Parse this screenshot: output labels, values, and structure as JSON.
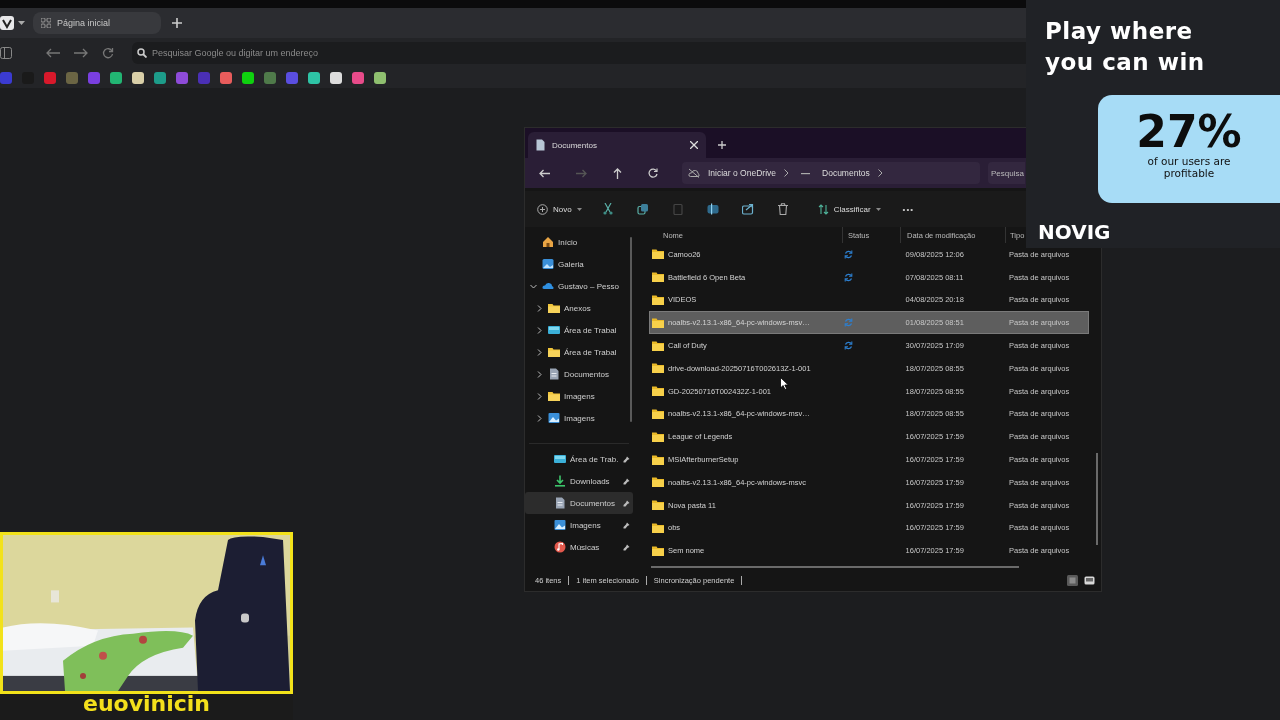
{
  "browser": {
    "tab": {
      "title": "Página inicial"
    },
    "address": {
      "placeholder": "Pesquisar Google ou digitar um endereço"
    },
    "bookmarks": [
      {
        "color": "#3b3bd1"
      },
      {
        "color": "#1a1a1a"
      },
      {
        "color": "#d8192b"
      },
      {
        "color": "#6b6544"
      },
      {
        "color": "#7a3fe0"
      },
      {
        "color": "#22b573"
      },
      {
        "color": "#d9cfa8"
      },
      {
        "color": "#1d9c8a"
      },
      {
        "color": "#8e4bd9"
      },
      {
        "color": "#4a2fb5"
      },
      {
        "color": "#e85c5c"
      },
      {
        "color": "#0fd10f"
      },
      {
        "color": "#4f7a4a"
      },
      {
        "color": "#5a4ee0"
      },
      {
        "color": "#2ec4a6"
      },
      {
        "color": "#dddddd"
      },
      {
        "color": "#e84b8a"
      },
      {
        "color": "#8fbf6f"
      }
    ]
  },
  "explorer": {
    "tab": {
      "title": "Documentos"
    },
    "breadcrumb": [
      "Iniciar o OneDrive",
      "Documentos"
    ],
    "search": {
      "placeholder": "Pesquisa"
    },
    "toolbar": {
      "new_label": "Novo",
      "sort_label": "Classificar",
      "more_label": "•••"
    },
    "sidebar": {
      "tree": [
        {
          "label": "Início",
          "kind": "home"
        },
        {
          "label": "Galeria",
          "kind": "gallery"
        },
        {
          "label": "Gustavo – Pesso",
          "kind": "cloud",
          "expanded": true,
          "children": [
            {
              "label": "Anexos",
              "kind": "folder",
              "expanded": false
            },
            {
              "label": "Área de Trabal",
              "kind": "desktop",
              "expanded": false
            },
            {
              "label": "Área de Trabal",
              "kind": "folder",
              "expanded": false
            },
            {
              "label": "Documentos",
              "kind": "document",
              "expanded": false
            },
            {
              "label": "Imagens",
              "kind": "folder",
              "expanded": false
            },
            {
              "label": "Imagens",
              "kind": "pictures",
              "expanded": false
            }
          ]
        }
      ],
      "quick_access": [
        {
          "label": "Área de Trab.",
          "kind": "desktop",
          "pinned": true,
          "selected": false
        },
        {
          "label": "Downloads",
          "kind": "download",
          "pinned": true,
          "selected": false
        },
        {
          "label": "Documentos",
          "kind": "document",
          "pinned": true,
          "selected": true
        },
        {
          "label": "Imagens",
          "kind": "pictures",
          "pinned": true,
          "selected": false
        },
        {
          "label": "Músicas",
          "kind": "music",
          "pinned": true,
          "selected": false
        }
      ]
    },
    "columns": [
      "Nome",
      "Status",
      "Data de modificação",
      "Tipo"
    ],
    "rows": [
      {
        "name": "Camoo26",
        "sync_pending": true,
        "modified": "09/08/2025 12:06",
        "type": "Pasta de arquivos",
        "selected": false
      },
      {
        "name": "Battlefield 6 Open Beta",
        "sync_pending": true,
        "modified": "07/08/2025 08:11",
        "type": "Pasta de arquivos",
        "selected": false
      },
      {
        "name": "VIDEOS",
        "sync_pending": false,
        "modified": "04/08/2025 20:18",
        "type": "Pasta de arquivos",
        "selected": false
      },
      {
        "name": "noalbs-v2.13.1-x86_64-pc-windows-msv…",
        "sync_pending": true,
        "modified": "01/08/2025 08:51",
        "type": "Pasta de arquivos",
        "selected": true
      },
      {
        "name": "Call of Duty",
        "sync_pending": true,
        "modified": "30/07/2025 17:09",
        "type": "Pasta de arquivos",
        "selected": false
      },
      {
        "name": "drive-download-20250716T002613Z-1-001",
        "sync_pending": false,
        "modified": "18/07/2025 08:55",
        "type": "Pasta de arquivos",
        "selected": false
      },
      {
        "name": "GD-20250716T002432Z-1-001",
        "sync_pending": false,
        "modified": "18/07/2025 08:55",
        "type": "Pasta de arquivos",
        "selected": false
      },
      {
        "name": "noalbs-v2.13.1-x86_64-pc-windows-msv…",
        "sync_pending": false,
        "modified": "18/07/2025 08:55",
        "type": "Pasta de arquivos",
        "selected": false
      },
      {
        "name": "League of Legends",
        "sync_pending": false,
        "modified": "16/07/2025 17:59",
        "type": "Pasta de arquivos",
        "selected": false
      },
      {
        "name": "MSIAfterburnerSetup",
        "sync_pending": false,
        "modified": "16/07/2025 17:59",
        "type": "Pasta de arquivos",
        "selected": false
      },
      {
        "name": "noalbs-v2.13.1-x86_64-pc-windows-msvc",
        "sync_pending": false,
        "modified": "16/07/2025 17:59",
        "type": "Pasta de arquivos",
        "selected": false
      },
      {
        "name": "Nova pasta 11",
        "sync_pending": false,
        "modified": "16/07/2025 17:59",
        "type": "Pasta de arquivos",
        "selected": false
      },
      {
        "name": "obs",
        "sync_pending": false,
        "modified": "16/07/2025 17:59",
        "type": "Pasta de arquivos",
        "selected": false
      },
      {
        "name": "Sem nome",
        "sync_pending": false,
        "modified": "16/07/2025 17:59",
        "type": "Pasta de arquivos",
        "selected": false
      }
    ],
    "status_bar": [
      "46 itens",
      "1 item selecionado",
      "Sincronização pendente"
    ]
  },
  "ad": {
    "headline": "Play where you can win",
    "stat": "27%",
    "stat_caption": "of our users are profitable",
    "brand": "NOVIG"
  },
  "webcam": {
    "kind": "picture",
    "channel_name": "euovinicin"
  }
}
